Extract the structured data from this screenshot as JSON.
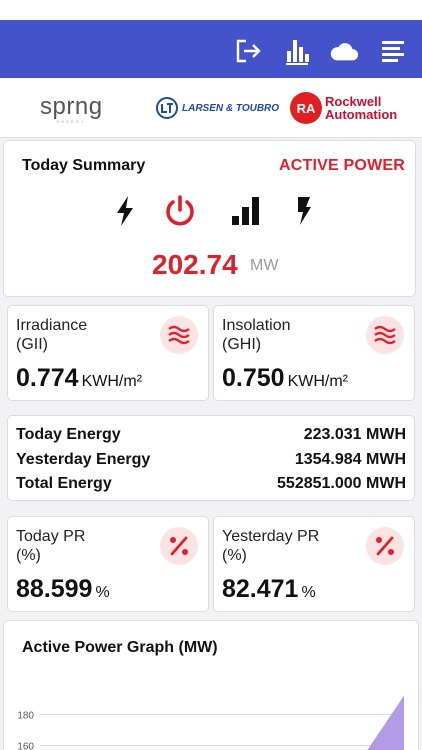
{
  "brands": {
    "sprng": "sprng",
    "sprng_sub": "ENERGY",
    "lt": "LARSEN & TOUBRO",
    "rockwell_line1": "Rockwell",
    "rockwell_line2": "Automation",
    "rockwell_mark": "RA"
  },
  "colors": {
    "appbar": "#4453c9",
    "accent_red": "#e0202a",
    "badge_bg": "#fce3e3",
    "graph_fill": "#b39be8"
  },
  "appbar_icons": [
    "logout-icon",
    "bar-chart-icon",
    "cloud-icon",
    "menu-icon"
  ],
  "summary": {
    "title": "Today Summary",
    "mode": "ACTIVE POWER",
    "icons": [
      "lightning-icon",
      "power-icon",
      "signal-bars-icon",
      "bolt-icon"
    ],
    "value": "202.74",
    "unit": "MW"
  },
  "irradiance": {
    "label_line1": "Irradiance",
    "label_line2": "(GII)",
    "value": "0.774",
    "unit": "KWH/m²",
    "icon": "heat-waves-icon"
  },
  "insolation": {
    "label_line1": "Insolation",
    "label_line2": "(GHI)",
    "value": "0.750",
    "unit": "KWH/m²",
    "icon": "heat-waves-icon"
  },
  "energy": {
    "rows": [
      {
        "label": "Today Energy",
        "value": "223.031 MWH"
      },
      {
        "label": "Yesterday Energy",
        "value": "1354.984 MWH"
      },
      {
        "label": "Total Energy",
        "value": "552851.000 MWH"
      }
    ]
  },
  "today_pr": {
    "label_line1": "Today PR",
    "label_line2": "(%)",
    "value": "88.599",
    "unit": "%",
    "icon": "percent-icon"
  },
  "yesterday_pr": {
    "label_line1": "Yesterday PR",
    "label_line2": "(%)",
    "value": "82.471",
    "unit": "%",
    "icon": "percent-icon"
  },
  "graph": {
    "title": "Active Power Graph (MW)"
  },
  "chart_data": {
    "type": "area",
    "title": "Active Power Graph (MW)",
    "y_ticks": [
      "180",
      "160"
    ],
    "visible_ylim": [
      150,
      195
    ],
    "series": [
      {
        "values_right_edge": [
          150,
          192
        ]
      }
    ]
  }
}
